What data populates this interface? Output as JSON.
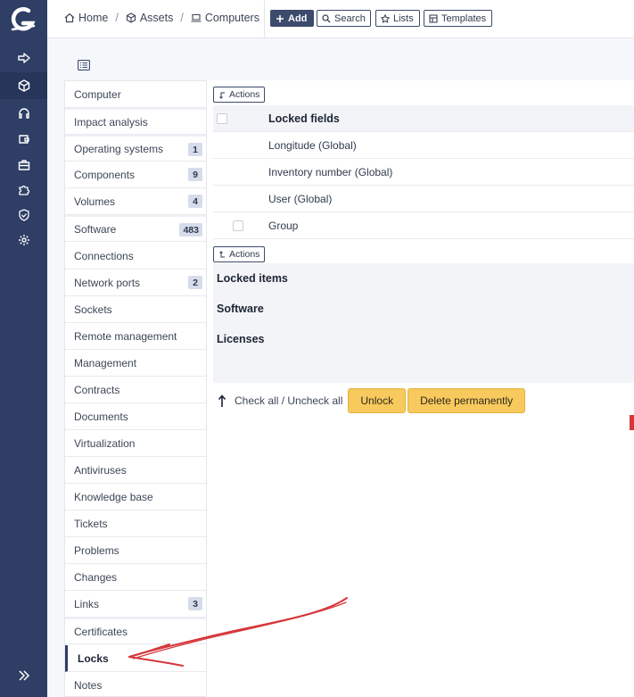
{
  "breadcrumb": {
    "home": "Home",
    "assets": "Assets",
    "computers": "Computers",
    "separator": "/"
  },
  "toolbar": {
    "add": "Add",
    "search": "Search",
    "lists": "Lists",
    "templates": "Templates"
  },
  "tabs": [
    {
      "label": "Computer",
      "badge": ""
    },
    {
      "label": "Impact analysis",
      "badge": ""
    },
    {
      "label": "Operating systems",
      "badge": "1"
    },
    {
      "label": "Components",
      "badge": "9"
    },
    {
      "label": "Volumes",
      "badge": "4"
    },
    {
      "label": "Software",
      "badge": "483"
    },
    {
      "label": "Connections",
      "badge": ""
    },
    {
      "label": "Network ports",
      "badge": "2"
    },
    {
      "label": "Sockets",
      "badge": ""
    },
    {
      "label": "Remote management",
      "badge": ""
    },
    {
      "label": "Management",
      "badge": ""
    },
    {
      "label": "Contracts",
      "badge": ""
    },
    {
      "label": "Documents",
      "badge": ""
    },
    {
      "label": "Virtualization",
      "badge": ""
    },
    {
      "label": "Antiviruses",
      "badge": ""
    },
    {
      "label": "Knowledge base",
      "badge": ""
    },
    {
      "label": "Tickets",
      "badge": ""
    },
    {
      "label": "Problems",
      "badge": ""
    },
    {
      "label": "Changes",
      "badge": ""
    },
    {
      "label": "Links",
      "badge": "3"
    },
    {
      "label": "Certificates",
      "badge": ""
    },
    {
      "label": "Locks",
      "badge": ""
    },
    {
      "label": "Notes",
      "badge": ""
    }
  ],
  "active_tab": "Locks",
  "locks": {
    "actions_label": "Actions",
    "fields_header": "Locked fields",
    "fields": [
      "Longitude (Global)",
      "Inventory number (Global)",
      "User (Global)",
      "Group"
    ],
    "items_header": "Locked items",
    "item_groups": [
      "Software",
      "Licenses"
    ],
    "check_all": "Check all / Uncheck all",
    "unlock": "Unlock",
    "delete_permanently": "Delete permanently"
  },
  "colors": {
    "nav_bg": "#2e3e65",
    "accent_button": "#f8c95c",
    "annotation": "#d6373b"
  },
  "icons": {
    "nav": [
      "arrow-right-icon",
      "cube-icon",
      "headset-icon",
      "wallet-icon",
      "briefcase-icon",
      "puzzle-icon",
      "shield-check-icon",
      "gear-icon"
    ],
    "collapse": "chevrons-right-icon"
  }
}
